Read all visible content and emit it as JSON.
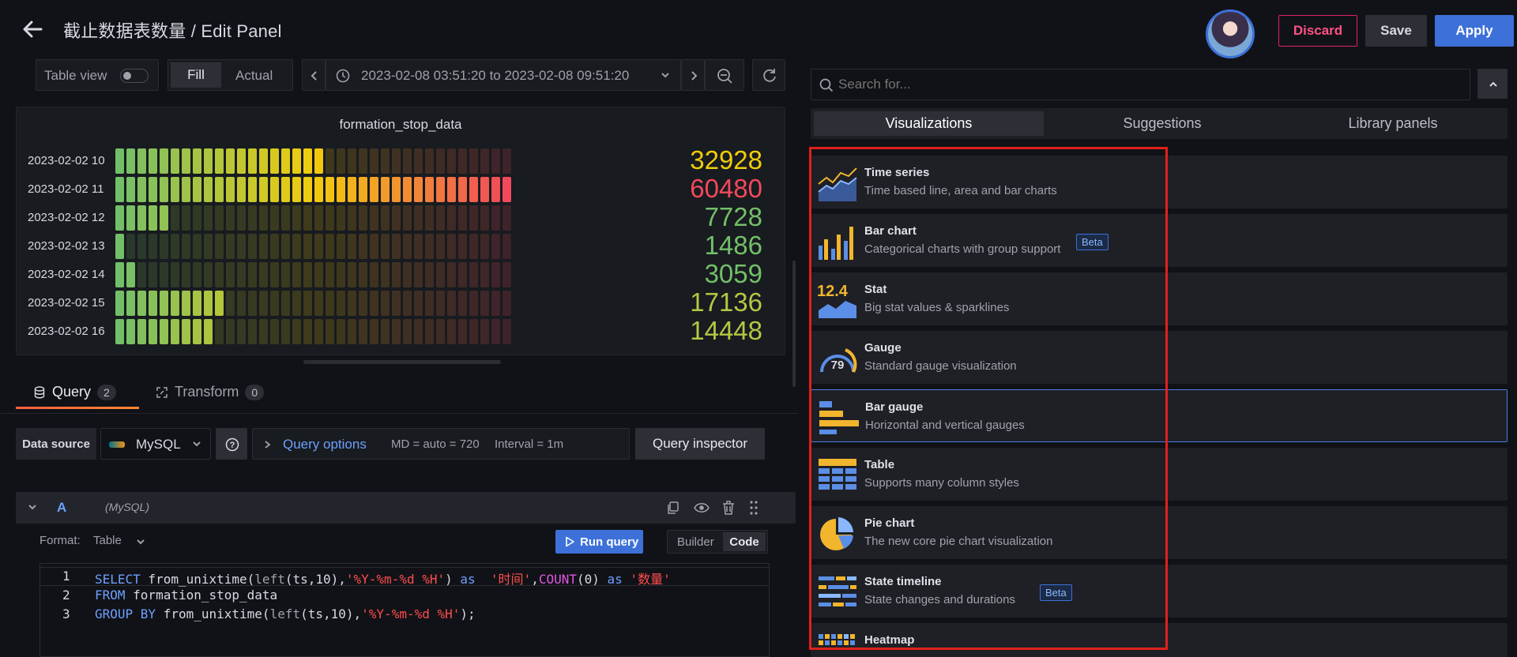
{
  "header": {
    "title": "截止数据表数量 / Edit Panel",
    "discard_label": "Discard",
    "save_label": "Save",
    "apply_label": "Apply"
  },
  "toolbar": {
    "table_view_label": "Table view",
    "fill_label": "Fill",
    "actual_label": "Actual",
    "time_range": "2023-02-08 03:51:20 to 2023-02-08 09:51:20"
  },
  "panel": {
    "title": "formation_stop_data",
    "rows": [
      {
        "label": "2023-02-02 10",
        "value": "32928",
        "fraction": 0.54,
        "color": "#f2cc0c"
      },
      {
        "label": "2023-02-02 11",
        "value": "60480",
        "fraction": 1.0,
        "color": "#f2495c"
      },
      {
        "label": "2023-02-02 12",
        "value": "7728",
        "fraction": 0.13,
        "color": "#73bf69"
      },
      {
        "label": "2023-02-02 13",
        "value": "1486",
        "fraction": 0.02,
        "color": "#73bf69"
      },
      {
        "label": "2023-02-02 14",
        "value": "3059",
        "fraction": 0.05,
        "color": "#73bf69"
      },
      {
        "label": "2023-02-02 15",
        "value": "17136",
        "fraction": 0.28,
        "color": "#b5c744"
      },
      {
        "label": "2023-02-02 16",
        "value": "14448",
        "fraction": 0.24,
        "color": "#b5c744"
      }
    ]
  },
  "tabs": {
    "query_label": "Query",
    "query_count": "2",
    "transform_label": "Transform",
    "transform_count": "0"
  },
  "query": {
    "datasource_label": "Data source",
    "datasource_value": "MySQL",
    "options_label": "Query options",
    "md_text": "MD = auto = 720",
    "interval_text": "Interval = 1m",
    "inspector_label": "Query inspector",
    "ref_id": "A",
    "ref_source": "(MySQL)",
    "format_label": "Format:",
    "format_value": "Table",
    "run_label": "Run query",
    "builder_label": "Builder",
    "code_label": "Code",
    "lines": [
      {
        "n": "1",
        "parts": [
          [
            "kw",
            "SELECT"
          ],
          [
            "pl",
            " from_unixtime("
          ],
          [
            "fn",
            "left"
          ],
          [
            "pl",
            "(ts,10),"
          ],
          [
            "str",
            "'%Y-%m-%d %H'"
          ],
          [
            "pl",
            ") "
          ],
          [
            "kw",
            "as"
          ],
          [
            "pl",
            "  "
          ],
          [
            "str",
            "'时间'"
          ],
          [
            "pl",
            ","
          ],
          [
            "fn2",
            "COUNT"
          ],
          [
            "pl",
            "(0) "
          ],
          [
            "kw",
            "as"
          ],
          [
            "pl",
            " "
          ],
          [
            "str",
            "'数量'"
          ]
        ]
      },
      {
        "n": "2",
        "parts": [
          [
            "kw",
            "FROM"
          ],
          [
            "pl",
            " formation_stop_data"
          ]
        ]
      },
      {
        "n": "3",
        "parts": [
          [
            "kw",
            "GROUP BY"
          ],
          [
            "pl",
            " from_unixtime("
          ],
          [
            "fn",
            "left"
          ],
          [
            "pl",
            "(ts,10),"
          ],
          [
            "str",
            "'%Y-%m-%d %H'"
          ],
          [
            "pl",
            ");"
          ]
        ]
      }
    ]
  },
  "right": {
    "search_placeholder": "Search for...",
    "tabs": [
      "Visualizations",
      "Suggestions",
      "Library panels"
    ],
    "items": [
      {
        "name": "Time series",
        "desc": "Time based line, area and bar charts",
        "icon": "time-series-icon",
        "beta": ""
      },
      {
        "name": "Bar chart",
        "desc": "Categorical charts with group support",
        "icon": "bar-chart-icon",
        "beta": "Beta"
      },
      {
        "name": "Stat",
        "desc": "Big stat values & sparklines",
        "icon": "stat-icon",
        "beta": "",
        "icon_text": "12.4"
      },
      {
        "name": "Gauge",
        "desc": "Standard gauge visualization",
        "icon": "gauge-icon",
        "beta": "",
        "icon_text": "79"
      },
      {
        "name": "Bar gauge",
        "desc": "Horizontal and vertical gauges",
        "icon": "bar-gauge-icon",
        "beta": ""
      },
      {
        "name": "Table",
        "desc": "Supports many column styles",
        "icon": "table-icon",
        "beta": ""
      },
      {
        "name": "Pie chart",
        "desc": "The new core pie chart visualization",
        "icon": "pie-chart-icon",
        "beta": ""
      },
      {
        "name": "State timeline",
        "desc": "State changes and durations",
        "icon": "state-timeline-icon",
        "beta": "Beta"
      },
      {
        "name": "Heatmap",
        "desc": "",
        "icon": "heatmap-icon",
        "beta": ""
      }
    ]
  }
}
